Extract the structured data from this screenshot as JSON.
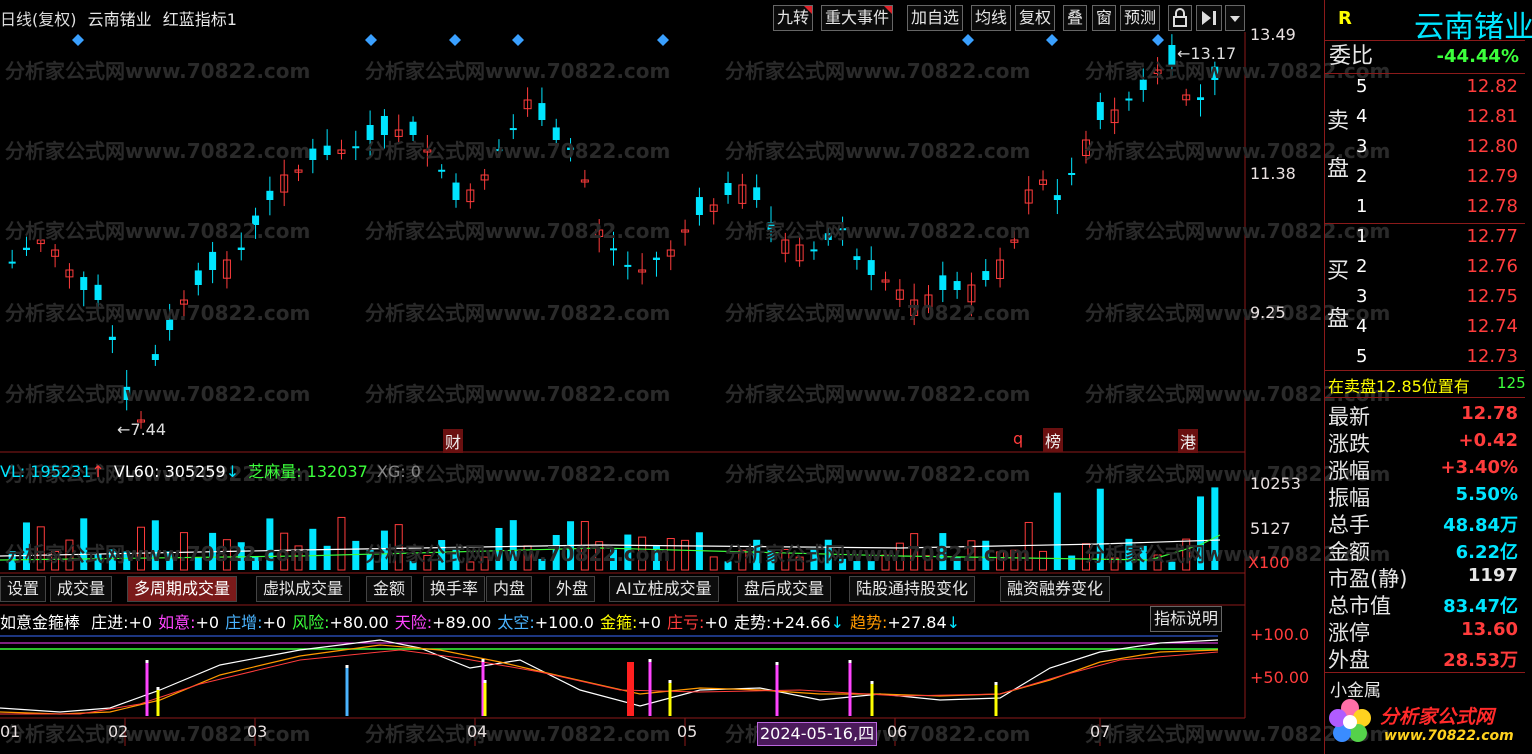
{
  "header": {
    "title_prefix": "日线(复权)",
    "stock_name": "云南锗业",
    "indicator_name": "红蓝指标1"
  },
  "toolbar": [
    "九转",
    "重大事件",
    "加自选",
    "均线",
    "复权",
    "叠",
    "窗",
    "预测"
  ],
  "toolbar_icons": {
    "lock": "lock-icon",
    "play": "play-icon",
    "dropdown": "dropdown-icon"
  },
  "price_axis": [
    "13.49",
    "11.38",
    "9.25"
  ],
  "price_marks": {
    "high": "13.17",
    "low": "7.44"
  },
  "event_marks": [
    "财",
    "q",
    "榜",
    "港"
  ],
  "volume_info": {
    "vl_label": "VL: 195231",
    "vl_arrow": "↑",
    "vl60_label": "VL60: 305259",
    "vl60_arrow": "↓",
    "zmv_label": "芝麻量: 132037",
    "xg_label": "XG: 0"
  },
  "volume_axis": [
    "10253",
    "5127",
    "X100"
  ],
  "tabs": [
    "设置",
    "成交量",
    "多周期成交量",
    "虚拟成交量",
    "金额",
    "换手率",
    "内盘",
    "外盘",
    "AI立桩成交量",
    "盘后成交量",
    "陆股通持股变化",
    "融资融券变化"
  ],
  "active_tab": "多周期成交量",
  "indicator": {
    "name": "如意金箍棒",
    "items": [
      {
        "label": "庄进:",
        "value": "+0",
        "color": "#ffffff"
      },
      {
        "label": "如意:",
        "value": "+0",
        "color": "#ff44ff"
      },
      {
        "label": "庄增:",
        "value": "+0",
        "color": "#4ab4ff"
      },
      {
        "label": "风险:",
        "value": "+80.00",
        "color": "#3cff3c"
      },
      {
        "label": "天险:",
        "value": "+89.00",
        "color": "#ff44ff"
      },
      {
        "label": "太空:",
        "value": "+100.0",
        "color": "#4ab4ff"
      },
      {
        "label": "金箍:",
        "value": "+0",
        "color": "#ffff00"
      },
      {
        "label": "庄亏:",
        "value": "+0",
        "color": "#ff3c3c"
      },
      {
        "label": "走势:",
        "value": "+24.66",
        "color": "#ffffff",
        "arrow": "↓"
      },
      {
        "label": "趋势:",
        "value": "+27.84",
        "color": "#ff9900",
        "arrow": "↓"
      }
    ],
    "help_button": "指标说明",
    "axis": [
      "+100.0",
      "+50.00"
    ]
  },
  "date_axis": [
    "01",
    "02",
    "03",
    "04",
    "05",
    "06",
    "07"
  ],
  "date_cursor": "2024-05-16,四",
  "watermark": "分析家公式网www.70822.com",
  "right_panel": {
    "r_badge": "R",
    "stock_name": "云南锗业",
    "weibi_label": "委比",
    "weibi_value": "-44.44%",
    "sell_label": [
      "卖",
      "盘"
    ],
    "buy_label": [
      "买",
      "盘"
    ],
    "sell_levels": [
      {
        "level": "5",
        "price": "12.82"
      },
      {
        "level": "4",
        "price": "12.81"
      },
      {
        "level": "3",
        "price": "12.80"
      },
      {
        "level": "2",
        "price": "12.79"
      },
      {
        "level": "1",
        "price": "12.78"
      }
    ],
    "buy_levels": [
      {
        "level": "1",
        "price": "12.77"
      },
      {
        "level": "2",
        "price": "12.76"
      },
      {
        "level": "3",
        "price": "12.75"
      },
      {
        "level": "4",
        "price": "12.74"
      },
      {
        "level": "5",
        "price": "12.73"
      }
    ],
    "position_note": "在卖盘12.85位置有",
    "position_value": "125",
    "stats": [
      {
        "label": "最新",
        "value": "12.78",
        "color": "#ff3c3c"
      },
      {
        "label": "涨跌",
        "value": "+0.42",
        "color": "#ff3c3c"
      },
      {
        "label": "涨幅",
        "value": "+3.40%",
        "color": "#ff3c3c"
      },
      {
        "label": "振幅",
        "value": "5.50%",
        "color": "#00e5ff"
      },
      {
        "label": "总手",
        "value": "48.84万",
        "color": "#00e5ff"
      },
      {
        "label": "金额",
        "value": "6.22亿",
        "color": "#00e5ff"
      },
      {
        "label": "市盈(静)",
        "value": "1197",
        "color": "#e6e6e6"
      },
      {
        "label": "总市值",
        "value": "83.47亿",
        "color": "#00e5ff"
      },
      {
        "label": "涨停",
        "value": "13.60",
        "color": "#ff3c3c"
      },
      {
        "label": "外盘",
        "value": "28.53万",
        "color": "#ff3c3c"
      }
    ],
    "sector": "小金属",
    "logo_text": "分析家公式网",
    "logo_url": "www.70822.com"
  }
}
